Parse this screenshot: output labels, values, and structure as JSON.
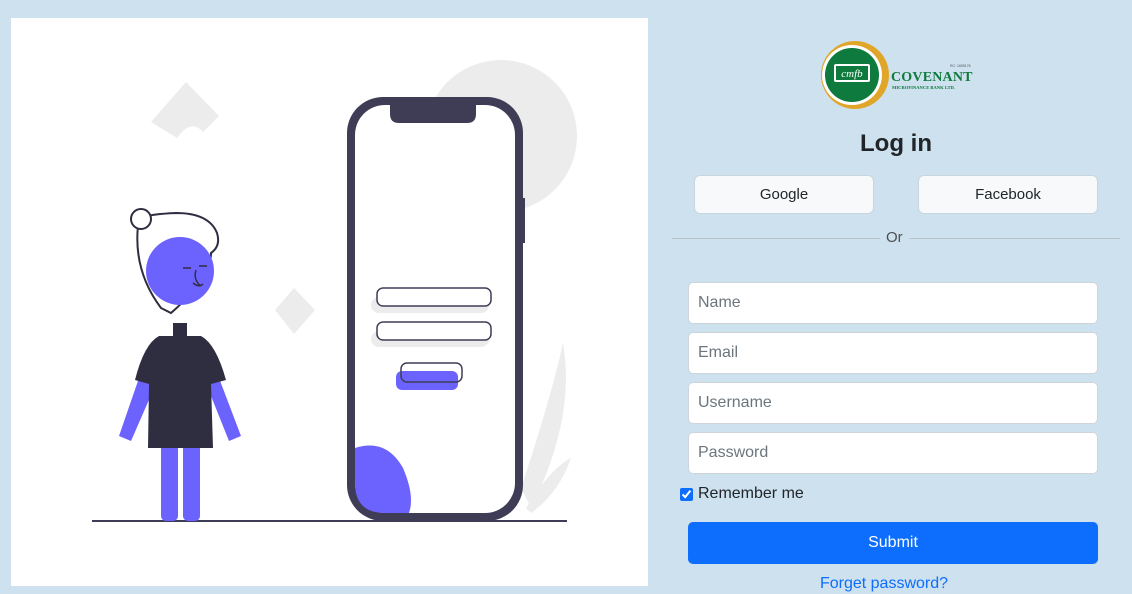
{
  "brand": {
    "logo_initials": "cmfb",
    "name": "COVENANT",
    "tagline": "MICROFINANCE BANK LTD.",
    "reg_no": "RC: 1695176",
    "colors": {
      "green": "#0f7a3d",
      "gold": "#e0a62a"
    }
  },
  "login": {
    "title": "Log in",
    "google_label": "Google",
    "facebook_label": "Facebook",
    "divider_text": "Or",
    "name_placeholder": "Name",
    "email_placeholder": "Email",
    "username_placeholder": "Username",
    "password_placeholder": "Password",
    "remember_label": "Remember me",
    "remember_checked": true,
    "submit_label": "Submit",
    "forgot_label": "Forget password?"
  },
  "colors": {
    "page_bg": "#cde1ee",
    "primary": "#0d6efd",
    "illustration_accent": "#6c63ff",
    "illustration_dark": "#3f3d56"
  }
}
